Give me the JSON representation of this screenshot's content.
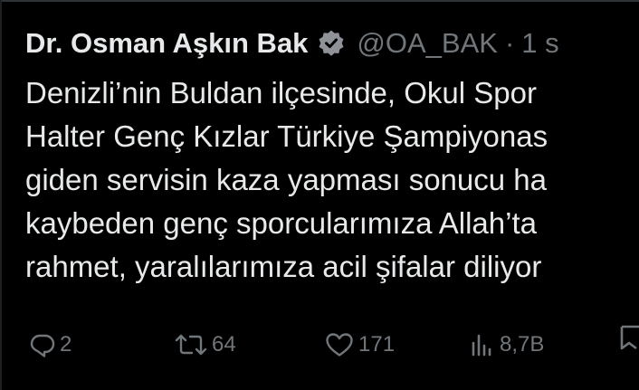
{
  "tweet": {
    "author_name": "Dr. Osman Aşkın Bak",
    "handle": "@OA_BAK",
    "separator": "·",
    "time": "1 s",
    "verified": true,
    "body_lines": [
      "Denizli’nin Buldan ilçesinde, Okul Spor",
      "Halter Genç Kızlar Türkiye Şampiyonas",
      "giden servisin kaza yapması sonucu ha",
      "kaybeden genç sporcularımıza Allah’ta",
      "rahmet, yaralılarımıza acil şifalar diliyor"
    ],
    "actions": {
      "replies": "2",
      "reposts": "64",
      "likes": "171",
      "views": "8,7B"
    }
  },
  "icons": {
    "verified": "verified-badge-icon",
    "reply": "reply-icon",
    "repost": "repost-icon",
    "like": "heart-icon",
    "views": "views-icon",
    "bookmark": "bookmark-icon"
  },
  "colors": {
    "background": "#000000",
    "text": "#e7e9ea",
    "secondary": "#71767b",
    "divider": "#2f3336"
  }
}
